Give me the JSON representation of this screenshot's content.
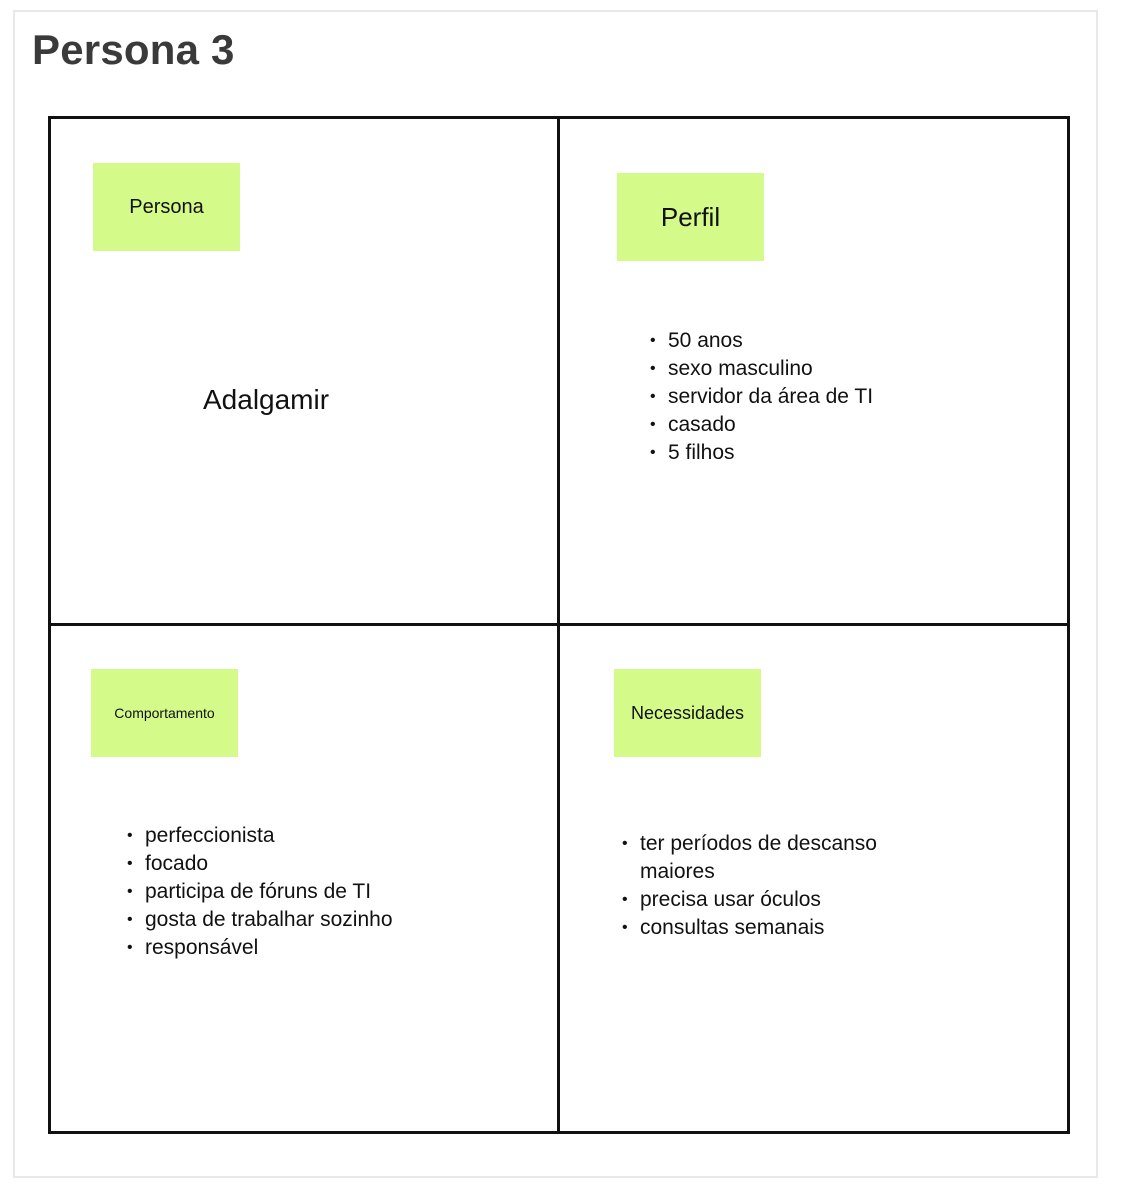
{
  "title": "Persona 3",
  "quadrants": {
    "persona": {
      "label": "Persona",
      "name": "Adalgamir"
    },
    "perfil": {
      "label": "Perfil",
      "items": [
        "50 anos",
        "sexo masculino",
        "servidor da área de TI",
        "casado",
        "5 filhos"
      ]
    },
    "comportamento": {
      "label": "Comportamento",
      "items": [
        "perfeccionista",
        "focado",
        "participa de fóruns de TI",
        "gosta de trabalhar sozinho",
        "responsável"
      ]
    },
    "necessidades": {
      "label": "Necessidades",
      "items": [
        "ter períodos de descanso maiores",
        "precisa usar óculos",
        "consultas semanais"
      ]
    }
  },
  "colors": {
    "sticky": "#d4fa8a",
    "border": "#111111",
    "title": "#3a3a3a"
  }
}
